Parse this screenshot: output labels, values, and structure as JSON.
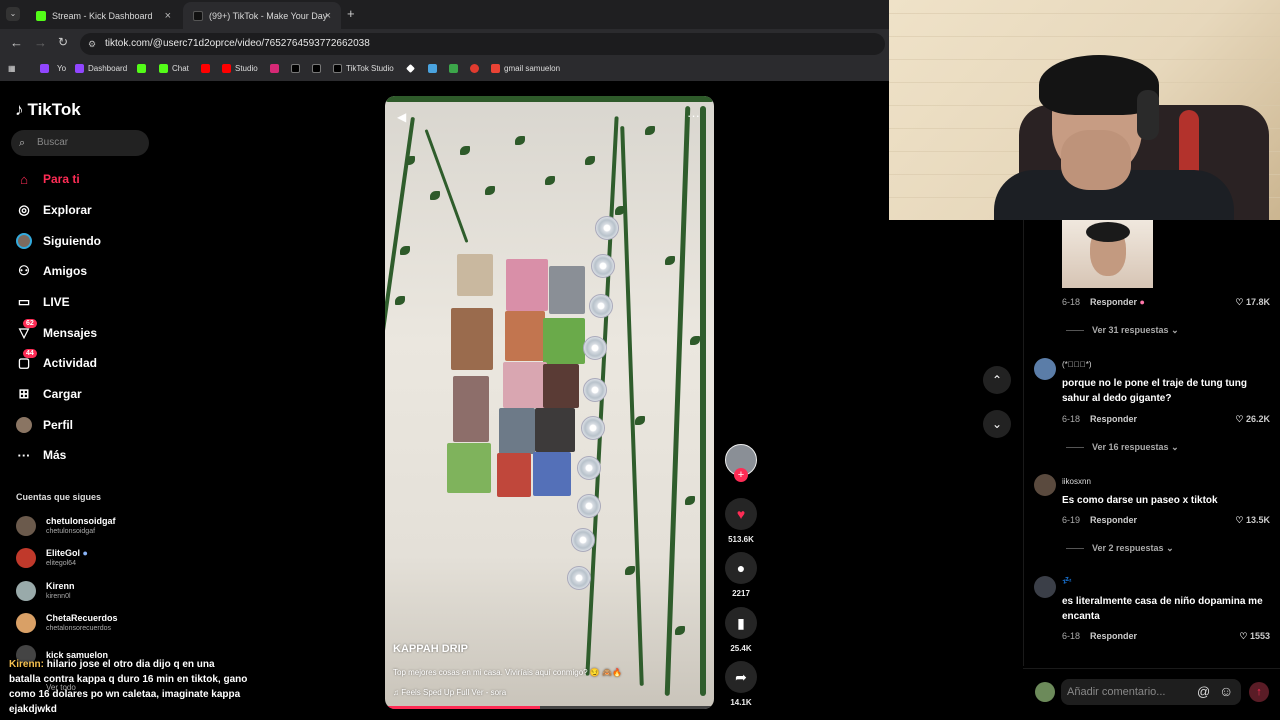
{
  "browser": {
    "tabs": [
      {
        "label": "Stream - Kick Dashboard",
        "color": "#53fc18"
      },
      {
        "label": "(99+) TikTok - Make Your Day",
        "color": "#111111"
      }
    ],
    "url": "tiktok.com/@userc71d2oprce/video/7652764593772662038",
    "bookmarks": [
      "Yo",
      "Dashboard",
      "Chat",
      "Studio",
      "TikTok Studio",
      "gmail samuelon"
    ]
  },
  "sidebar": {
    "logo": "TikTok",
    "search_placeholder": "Buscar",
    "nav": [
      {
        "label": "Para ti",
        "icon": "home-icon",
        "active": true
      },
      {
        "label": "Explorar",
        "icon": "compass-icon"
      },
      {
        "label": "Siguiendo",
        "icon": "following-avatar-icon"
      },
      {
        "label": "Amigos",
        "icon": "friends-icon"
      },
      {
        "label": "LIVE",
        "icon": "live-icon"
      },
      {
        "label": "Mensajes",
        "icon": "messages-icon",
        "badge": "62"
      },
      {
        "label": "Actividad",
        "icon": "activity-icon",
        "badge": "44"
      },
      {
        "label": "Cargar",
        "icon": "upload-icon"
      },
      {
        "label": "Perfil",
        "icon": "profile-icon"
      },
      {
        "label": "Más",
        "icon": "more-icon"
      }
    ],
    "following_title": "Cuentas que sigues",
    "following": [
      {
        "name": "chetulonsoidgaf",
        "handle": "chetulonsoidgaf"
      },
      {
        "name": "EliteGol",
        "handle": "elitegol64"
      },
      {
        "name": "Kirenn",
        "handle": "kirenn0l"
      },
      {
        "name": "ChetaRecuerdos",
        "handle": "chetalonsorecuerdos"
      },
      {
        "name": "kick samuelon",
        "handle": ""
      }
    ],
    "see_all": "Ver todo"
  },
  "chat": {
    "user": "Kirenn:",
    "message": "hilario jose el otro dia dijo q en una batalla contra kappa q duro 16 min en tiktok, gano como 16 dolares po wn caletaa, imaginate kappa ejakdjwkd"
  },
  "video": {
    "author": "KAPPAH DRIP",
    "description": "Top mejores cosas en mi casa. Viviríais aquí conmigo? 😏 🙈🔥",
    "music": "Feels Sped Up Full Ver - sora",
    "progress": 0.47
  },
  "actions": {
    "likes": "513.6K",
    "comments": "2217",
    "saves": "25.4K",
    "shares": "14.1K"
  },
  "comments": [
    {
      "date": "6-18",
      "reply_label": "Responder",
      "likes": "17.8K",
      "replies": "Ver 31 respuestas"
    },
    {
      "user": "(*ﾟ∀ﾟ*)",
      "text": "porque no le pone el traje de tung tung sahur al dedo gigante?",
      "date": "6-18",
      "reply_label": "Responder",
      "likes": "26.2K",
      "replies": "Ver 16 respuestas"
    },
    {
      "user": "iikosxnn",
      "text": "Es como darse un paseo x tiktok",
      "date": "6-19",
      "reply_label": "Responder",
      "likes": "13.5K",
      "replies": "Ver 2 respuestas"
    },
    {
      "user": "💤",
      "text": "es literalmente casa de niño dopamina me encanta",
      "date": "6-18",
      "reply_label": "Responder",
      "likes": "1553"
    }
  ],
  "comment_input_placeholder": "Añadir comentario..."
}
